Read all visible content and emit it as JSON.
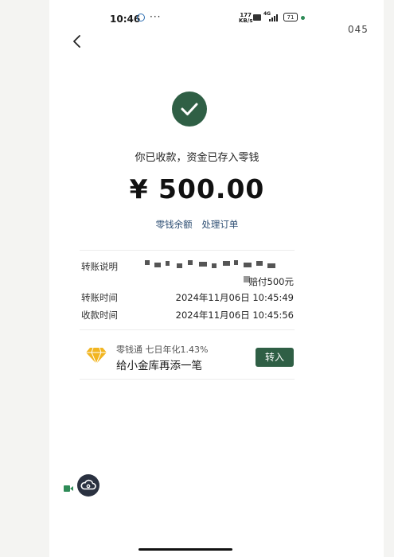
{
  "status_bar": {
    "time": "10:46",
    "more": "···",
    "speed": "177",
    "speed_unit": "KB/s",
    "network": "4G",
    "battery": "71"
  },
  "corner_text": "045",
  "result": {
    "title": "你已收款，资金已存入零钱",
    "amount": "¥ 500.00",
    "link_balance": "零钱余额",
    "link_order": "处理订单"
  },
  "details": {
    "remark_label": "转账说明",
    "remark_value": "赔付500元",
    "transfer_time_label": "转账时间",
    "transfer_time_value": "2024年11月06日 10:45:49",
    "receive_time_label": "收款时间",
    "receive_time_value": "2024年11月06日 10:45:56"
  },
  "promo": {
    "subtitle": "零钱通 七日年化1.43%",
    "main": "给小金库再添一笔",
    "button_label": "转入"
  },
  "colors": {
    "accent": "#2f5f45",
    "link": "#2d4e73",
    "gem": "#f2b520"
  },
  "icons": [
    "back-icon",
    "check-icon",
    "gem-icon",
    "video-icon",
    "cloud-icon"
  ]
}
